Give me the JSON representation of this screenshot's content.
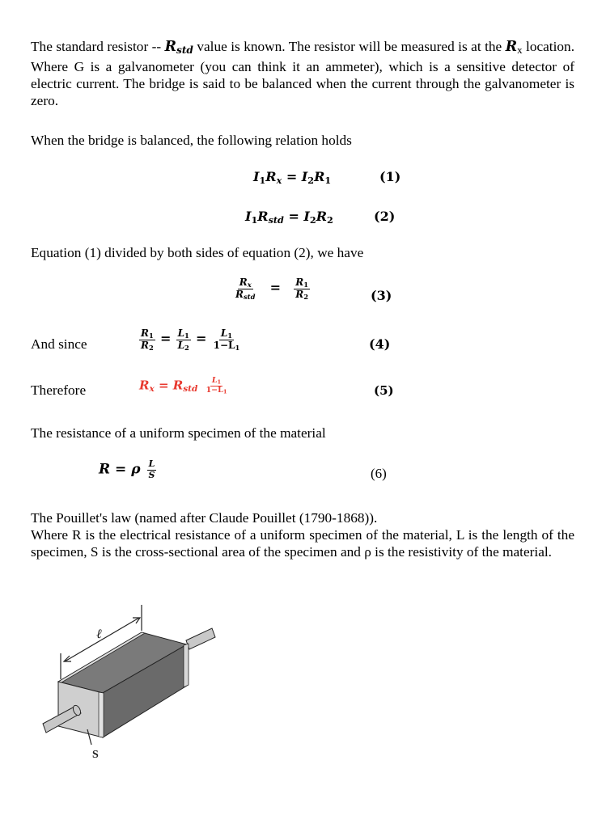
{
  "paragraphs": {
    "p1_before_rstd": "The standard resistor -- ",
    "p1_rstd_symbol": "R",
    "p1_rstd_sub": "std",
    "p1_after_rstd": " value is known. The resistor will be measured is at the ",
    "p1_rx_symbol": "R",
    "p1_rx_sub": "x",
    "p1_rest": " location.  Where G is a galvanometer (you can think it an ammeter), which is a sensitive detector of electric current.  The bridge is said to be balanced when the current through the galvanometer is zero.",
    "p2": "When the bridge is balanced, the following relation holds",
    "p3": "Equation (1) divided by both sides of equation (2), we have",
    "and_since": "And since",
    "therefore": "Therefore",
    "p4": "The resistance of a uniform specimen of the material",
    "p5_line1": "The Pouillet's law (named after Claude Pouillet (1790-1868)).",
    "p5_rest": "Where R is the electrical resistance of a uniform specimen of the material, L is the length of the specimen, S is the cross-sectional area of the specimen and ρ is the resistivity of the material."
  },
  "equations": {
    "eq1": {
      "I": "I",
      "one": "1",
      "R": "R",
      "x": "x",
      "eq": " = ",
      "I2": "I",
      "two": "2",
      "R2": "R",
      "r1": "1",
      "number": "(1)"
    },
    "eq2": {
      "I": "I",
      "one": "1",
      "R": "R",
      "std": "std",
      "eq": " = ",
      "I2": "I",
      "two": "2",
      "R2": "R",
      "r2": "2",
      "number": "(2)"
    },
    "eq3": {
      "num_left": "R",
      "num_left_sub": "x",
      "den_left": "R",
      "den_left_sub": "std",
      "eq": "=",
      "num_right": "R",
      "num_right_sub": "1",
      "den_right": "R",
      "den_right_sub": "2",
      "number": "(3)"
    },
    "eq4": {
      "r1": "R",
      "r1s": "1",
      "r2": "R",
      "r2s": "2",
      "l1": "L",
      "l1s": "1",
      "l2": "L",
      "l2s": "2",
      "l1b": "L",
      "l1bs": "1",
      "den3": "1−L",
      "den3s": "1",
      "eq": "=",
      "number": "(4)"
    },
    "eq5": {
      "rx": "R",
      "rxs": "x",
      "eq": " = ",
      "rstd": "R",
      "rstds": "std",
      "num": "L",
      "nums": "1",
      "den": "1−L",
      "dens": "1",
      "number": "(5)"
    },
    "eq6": {
      "R": "R",
      "eq": " = ",
      "rho": "ρ",
      "num": "L",
      "den": "S",
      "number": "(6)"
    }
  },
  "figure": {
    "length_label": "ℓ",
    "area_label": "S"
  },
  "colors": {
    "highlight": "#e8392f",
    "body_dark": "#6e6e6e",
    "face_light": "#cfcfcf",
    "wire": "#c8c8c8"
  }
}
